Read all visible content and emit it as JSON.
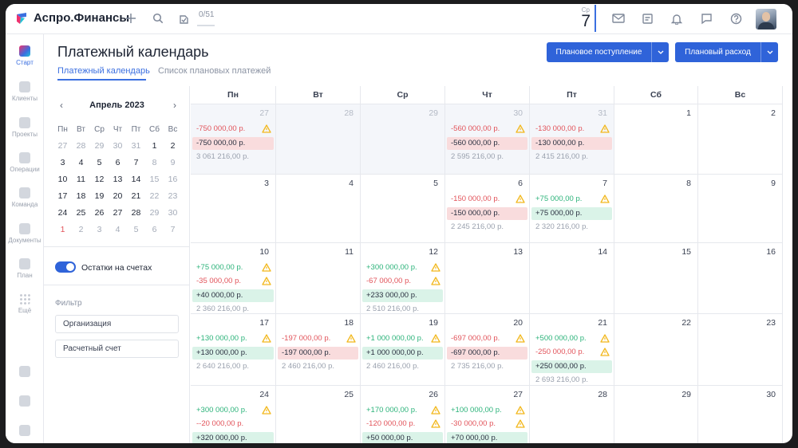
{
  "app": {
    "title": "Аспро.Финансы",
    "progress": "0/51"
  },
  "today": {
    "abbr": "Ср",
    "day": "7"
  },
  "icons": {
    "logo": "aspro-logo-icon",
    "add": "plus-icon",
    "search": "search-icon",
    "tasks": "task-check-icon",
    "mail": "mail-icon",
    "notes": "notes-icon",
    "bell": "bell-icon",
    "chat": "chat-icon",
    "help": "help-icon"
  },
  "nav": [
    {
      "label": "Старт",
      "icon": "start-icon",
      "active": true
    },
    {
      "label": "Клиенты",
      "icon": "clients-icon"
    },
    {
      "label": "Проекты",
      "icon": "projects-icon"
    },
    {
      "label": "Операции",
      "icon": "operations-icon"
    },
    {
      "label": "Команда",
      "icon": "team-icon"
    },
    {
      "label": "Документы",
      "icon": "documents-icon"
    },
    {
      "label": "План",
      "icon": "plan-icon"
    },
    {
      "label": "Ещё",
      "icon": "more-icon"
    }
  ],
  "page": {
    "title": "Платежный календарь",
    "tabs": [
      {
        "label": "Платежный календарь"
      },
      {
        "label": "Список плановых платежей"
      }
    ],
    "btn_income": "Плановое поступление",
    "btn_expense": "Плановый расход"
  },
  "mini_calendar": {
    "title": "Апрель 2023",
    "weekdays": [
      "Пн",
      "Вт",
      "Ср",
      "Чт",
      "Пт",
      "Сб",
      "Вс"
    ],
    "rows": [
      [
        "27",
        "28",
        "29",
        "30",
        "31",
        "1",
        "2"
      ],
      [
        "3",
        "4",
        "5",
        "6",
        "7",
        "8",
        "9"
      ],
      [
        "10",
        "11",
        "12",
        "13",
        "14",
        "15",
        "16"
      ],
      [
        "17",
        "18",
        "19",
        "20",
        "21",
        "22",
        "23"
      ],
      [
        "24",
        "25",
        "26",
        "27",
        "28",
        "29",
        "30"
      ],
      [
        "1",
        "2",
        "3",
        "4",
        "5",
        "6",
        "7"
      ]
    ]
  },
  "balances_toggle": "Остатки на счетах",
  "filter": {
    "label": "Фильтр",
    "org_placeholder": "Организация",
    "account_placeholder": "Расчетный счет"
  },
  "calendar": {
    "weekdays": [
      "Пн",
      "Вт",
      "Ср",
      "Чт",
      "Пт",
      "Сб",
      "Вс"
    ],
    "weeks": [
      [
        {
          "day": "27",
          "past": true,
          "entries": [
            {
              "type": "red",
              "text": "-750 000,00 р.",
              "warn": true
            }
          ],
          "total": {
            "type": "red",
            "text": "-750 000,00 р."
          },
          "balance": "3 061 216,00 р."
        },
        {
          "day": "28",
          "past": true
        },
        {
          "day": "29",
          "past": true
        },
        {
          "day": "30",
          "past": true,
          "entries": [
            {
              "type": "red",
              "text": "-560 000,00 р.",
              "warn": true
            }
          ],
          "total": {
            "type": "red",
            "text": "-560 000,00 р."
          },
          "balance": "2 595 216,00 р."
        },
        {
          "day": "31",
          "past": true,
          "entries": [
            {
              "type": "red",
              "text": "-130 000,00 р.",
              "warn": true
            }
          ],
          "total": {
            "type": "red",
            "text": "-130 000,00 р."
          },
          "balance": "2 415 216,00 р."
        },
        {
          "day": "1"
        },
        {
          "day": "2"
        }
      ],
      [
        {
          "day": "3"
        },
        {
          "day": "4"
        },
        {
          "day": "5"
        },
        {
          "day": "6",
          "entries": [
            {
              "type": "red",
              "text": "-150 000,00 р.",
              "warn": true
            }
          ],
          "total": {
            "type": "red",
            "text": "-150 000,00 р."
          },
          "balance": "2 245 216,00 р."
        },
        {
          "day": "7",
          "entries": [
            {
              "type": "green",
              "text": "+75 000,00 р.",
              "warn": true
            }
          ],
          "total": {
            "type": "green",
            "text": "+75 000,00 р."
          },
          "balance": "2 320 216,00 р."
        },
        {
          "day": "8"
        },
        {
          "day": "9"
        }
      ],
      [
        {
          "day": "10",
          "entries": [
            {
              "type": "green",
              "text": "+75 000,00 р.",
              "warn": true
            },
            {
              "type": "red",
              "text": "-35 000,00 р.",
              "warn": true
            }
          ],
          "total": {
            "type": "green",
            "text": "+40 000,00 р."
          },
          "balance": "2 360 216,00 р."
        },
        {
          "day": "11"
        },
        {
          "day": "12",
          "entries": [
            {
              "type": "green",
              "text": "+300 000,00 р.",
              "warn": true
            },
            {
              "type": "red",
              "text": "-67 000,00 р.",
              "warn": true
            }
          ],
          "total": {
            "type": "green",
            "text": "+233 000,00 р."
          },
          "balance": "2 510 216,00 р."
        },
        {
          "day": "13"
        },
        {
          "day": "14"
        },
        {
          "day": "15"
        },
        {
          "day": "16"
        }
      ],
      [
        {
          "day": "17",
          "entries": [
            {
              "type": "green",
              "text": "+130 000,00 р.",
              "warn": true
            }
          ],
          "total": {
            "type": "green",
            "text": "+130 000,00 р."
          },
          "balance": "2 640 216,00 р."
        },
        {
          "day": "18",
          "entries": [
            {
              "type": "red",
              "text": "-197 000,00 р.",
              "warn": true
            }
          ],
          "total": {
            "type": "red",
            "text": "-197 000,00 р."
          },
          "balance": "2 460 216,00 р."
        },
        {
          "day": "19",
          "entries": [
            {
              "type": "green",
              "text": "+1 000 000,00 р.",
              "warn": true
            }
          ],
          "total": {
            "type": "green",
            "text": "+1 000 000,00 р."
          },
          "balance": "2 460 216,00 р."
        },
        {
          "day": "20",
          "entries": [
            {
              "type": "red",
              "text": "-697 000,00 р.",
              "warn": true
            }
          ],
          "total": {
            "type": "red",
            "text": "-697 000,00 р."
          },
          "balance": "2 735 216,00 р."
        },
        {
          "day": "21",
          "entries": [
            {
              "type": "green",
              "text": "+500 000,00 р.",
              "warn": true
            },
            {
              "type": "red",
              "text": "-250 000,00 р.",
              "warn": true
            }
          ],
          "total": {
            "type": "green",
            "text": "+250 000,00 р."
          },
          "balance": "2 693 216,00 р."
        },
        {
          "day": "22"
        },
        {
          "day": "23"
        }
      ],
      [
        {
          "day": "24",
          "entries": [
            {
              "type": "green",
              "text": "+300 000,00 р.",
              "warn": true
            },
            {
              "type": "red",
              "text": "--20 000,00 р.",
              "warn": false
            }
          ],
          "total": {
            "type": "green",
            "text": "+320 000,00 р."
          }
        },
        {
          "day": "25"
        },
        {
          "day": "26",
          "entries": [
            {
              "type": "green",
              "text": "+170 000,00 р.",
              "warn": true
            },
            {
              "type": "red",
              "text": "-120 000,00 р.",
              "warn": true
            }
          ],
          "total": {
            "type": "green",
            "text": "+50 000,00 р."
          }
        },
        {
          "day": "27",
          "entries": [
            {
              "type": "green",
              "text": "+100 000,00 р.",
              "warn": true
            },
            {
              "type": "red",
              "text": "-30 000,00 р.",
              "warn": true
            }
          ],
          "total": {
            "type": "green",
            "text": "+70 000,00 р."
          }
        },
        {
          "day": "28"
        },
        {
          "day": "29"
        },
        {
          "day": "30"
        }
      ]
    ]
  },
  "colors": {
    "accent": "#2f63d9",
    "income": "#2cb37a",
    "expense": "#e2545b",
    "warning": "#f2b81d"
  }
}
